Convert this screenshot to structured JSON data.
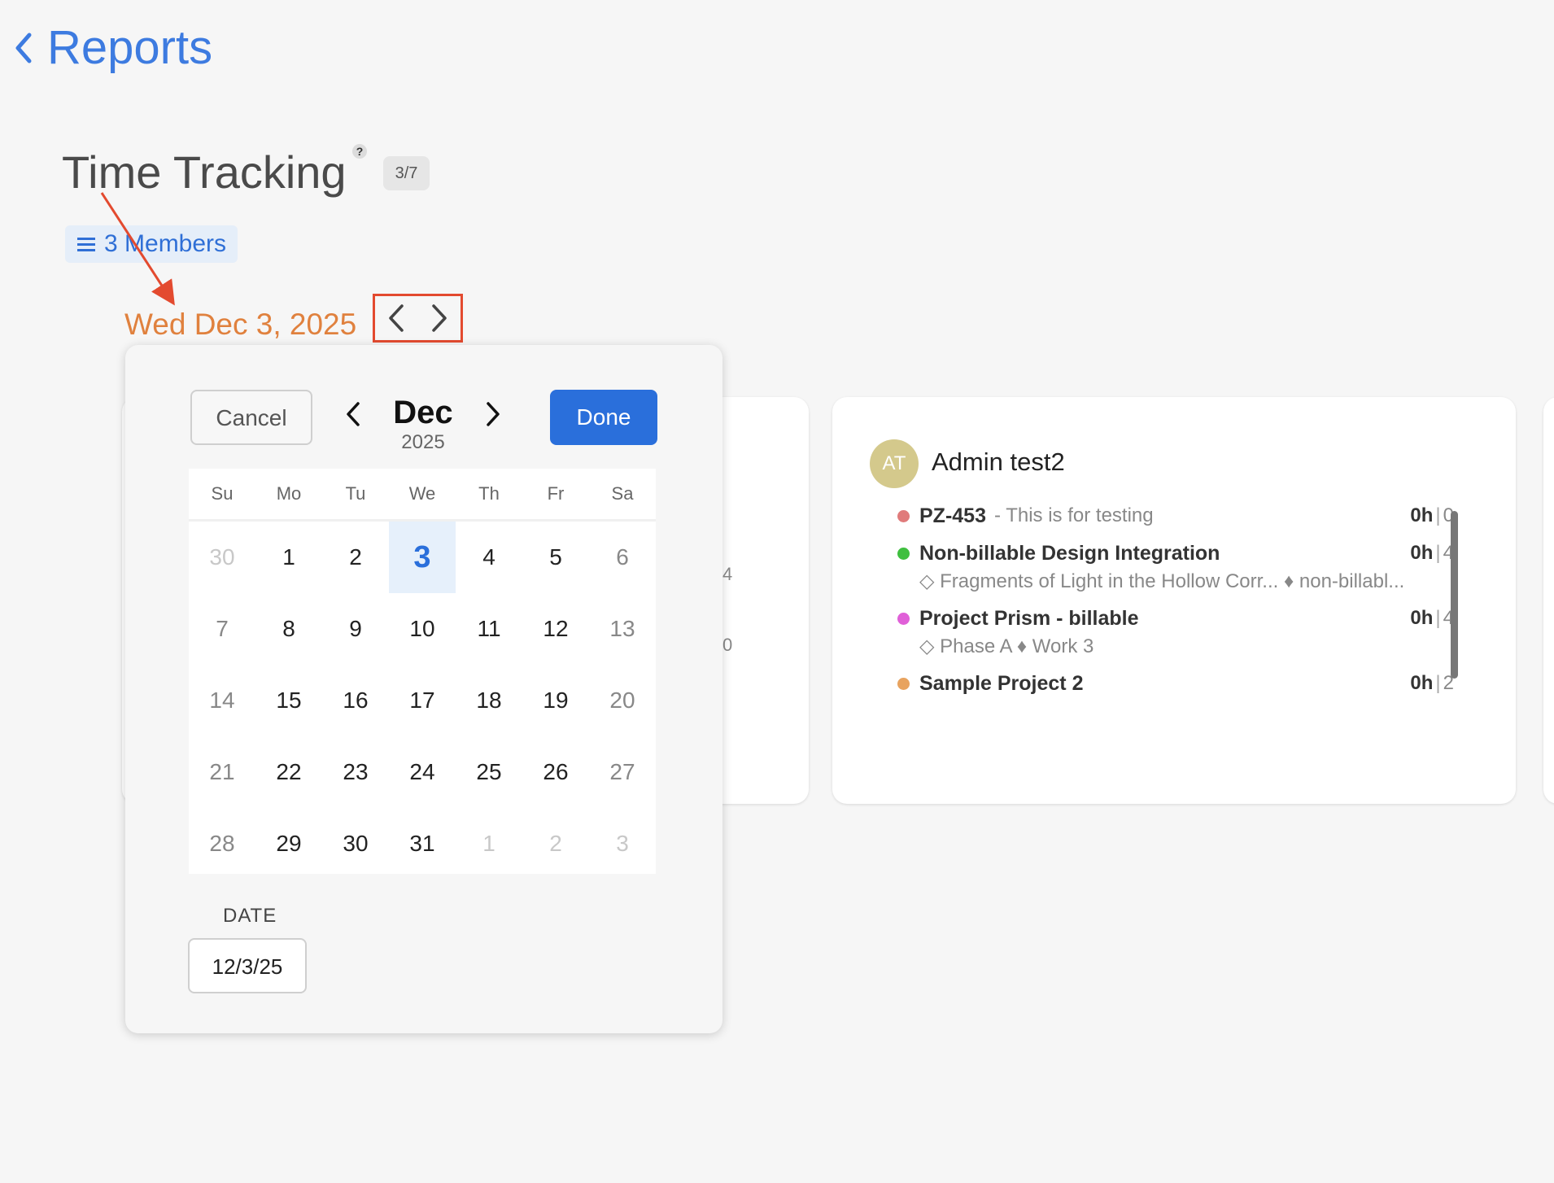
{
  "header": {
    "back_label": "Reports"
  },
  "page": {
    "title": "Time Tracking",
    "help_mark": "?",
    "count_badge": "3/7",
    "members_label": "3 Members",
    "current_date": "Wed Dec 3, 2025"
  },
  "colors": {
    "accent": "#2a6fdb",
    "date": "#e0813e",
    "annotation": "#e34a2f"
  },
  "left_card_fragments": [
    "4",
    "0"
  ],
  "member_card": {
    "initials": "AT",
    "name": "Admin test2",
    "entries": [
      {
        "name": "PZ-453",
        "desc": "- This is for testing",
        "hours": "0h",
        "count": "0",
        "color": "#e07b7b",
        "sub": ""
      },
      {
        "name": "Non-billable Design Integration",
        "desc": "",
        "hours": "0h",
        "count": "4",
        "color": "#3fbf3f",
        "sub": "◇ Fragments of Light in the Hollow Corr...  ♦ non-billabl..."
      },
      {
        "name": "Project Prism - billable",
        "desc": "",
        "hours": "0h",
        "count": "4",
        "color": "#e060d8",
        "sub": "◇ Phase A  ♦ Work 3"
      },
      {
        "name": "Sample Project 2",
        "desc": "",
        "hours": "0h",
        "count": "2",
        "color": "#e8a35f",
        "sub": ""
      }
    ]
  },
  "picker": {
    "cancel_label": "Cancel",
    "done_label": "Done",
    "month": "Dec",
    "year": "2025",
    "weekdays": [
      "Su",
      "Mo",
      "Tu",
      "We",
      "Th",
      "Fr",
      "Sa"
    ],
    "days": [
      {
        "d": "30",
        "muted": true
      },
      {
        "d": "1"
      },
      {
        "d": "2"
      },
      {
        "d": "3",
        "selected": true
      },
      {
        "d": "4"
      },
      {
        "d": "5"
      },
      {
        "d": "6"
      },
      {
        "d": "7"
      },
      {
        "d": "8"
      },
      {
        "d": "9"
      },
      {
        "d": "10"
      },
      {
        "d": "11"
      },
      {
        "d": "12"
      },
      {
        "d": "13"
      },
      {
        "d": "14"
      },
      {
        "d": "15"
      },
      {
        "d": "16"
      },
      {
        "d": "17"
      },
      {
        "d": "18"
      },
      {
        "d": "19"
      },
      {
        "d": "20"
      },
      {
        "d": "21"
      },
      {
        "d": "22"
      },
      {
        "d": "23"
      },
      {
        "d": "24"
      },
      {
        "d": "25"
      },
      {
        "d": "26"
      },
      {
        "d": "27"
      },
      {
        "d": "28"
      },
      {
        "d": "29"
      },
      {
        "d": "30"
      },
      {
        "d": "31"
      },
      {
        "d": "1",
        "muted": true
      },
      {
        "d": "2",
        "muted": true
      },
      {
        "d": "3",
        "muted": true
      }
    ],
    "date_label": "DATE",
    "date_value": "12/3/25"
  }
}
